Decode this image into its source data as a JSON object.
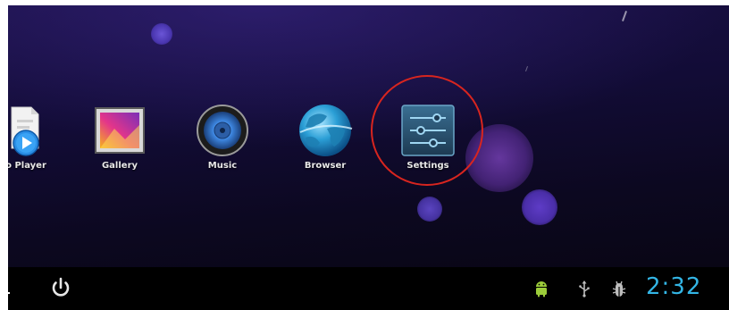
{
  "apps": [
    {
      "label": "o Player",
      "icon": "video-player-icon"
    },
    {
      "label": "Gallery",
      "icon": "gallery-icon"
    },
    {
      "label": "Music",
      "icon": "music-speaker-icon"
    },
    {
      "label": "Browser",
      "icon": "globe-browser-icon"
    },
    {
      "label": "Settings",
      "icon": "settings-sliders-icon"
    }
  ],
  "status_bar": {
    "time": "2:32",
    "icons": [
      "android-notification-icon",
      "usb-icon",
      "usb-debugging-icon"
    ],
    "clock_color": "#33b5e5"
  },
  "navigation": {
    "icons": [
      "power-icon"
    ]
  },
  "annotation_color": "#d8251f"
}
